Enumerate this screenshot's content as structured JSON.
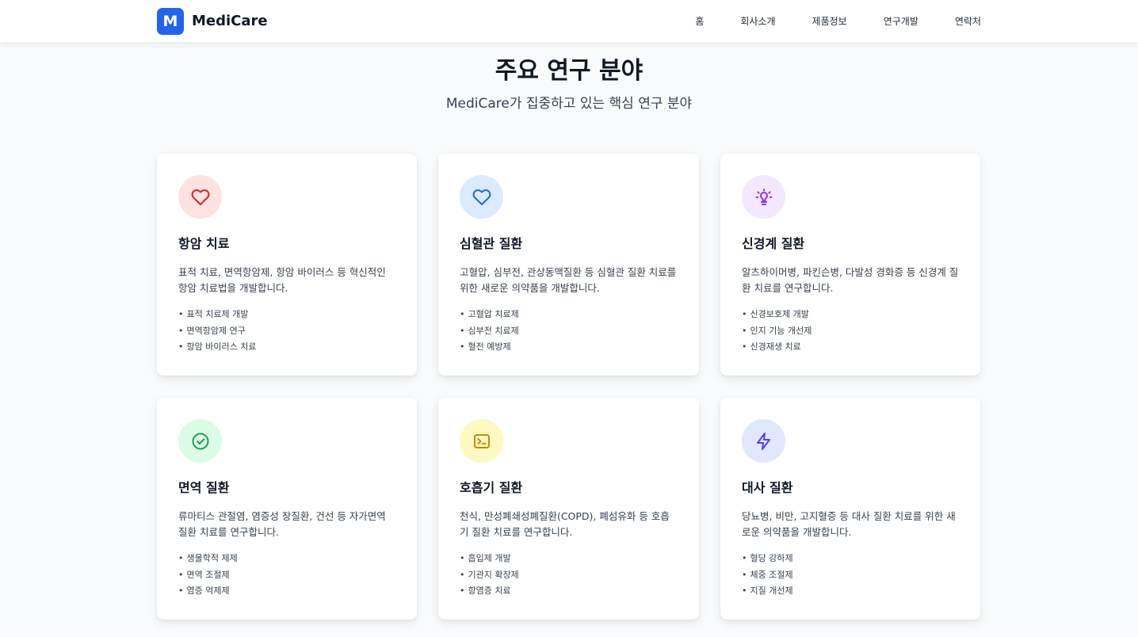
{
  "navbar": {
    "logo_letter": "M",
    "brand": "MediCare",
    "links": [
      "홈",
      "회사소개",
      "제품정보",
      "연구개발",
      "연락처"
    ]
  },
  "section": {
    "title": "주요 연구 분야",
    "subtitle": "MediCare가 집중하고 있는 핵심 연구 분야"
  },
  "colors": {
    "brand": "#2563eb"
  },
  "cards": [
    {
      "icon": "heart-icon",
      "icon_color": "#dc2626",
      "icon_bg": "#fee2e2",
      "title": "항암 치료",
      "desc": "표적 치료, 면역항암제, 항암 바이러스 등 혁신적인 항암 치료법을 개발합니다.",
      "items": [
        "표적 치료제 개발",
        "면역항암제 연구",
        "항암 바이러스 치료"
      ]
    },
    {
      "icon": "heart-icon",
      "icon_color": "#2563eb",
      "icon_bg": "#dbeafe",
      "title": "심혈관 질환",
      "desc": "고혈압, 심부전, 관상동맥질환 등 심혈관 질환 치료를 위한 새로운 의약품을 개발합니다.",
      "items": [
        "고혈압 치료제",
        "심부전 치료제",
        "혈전 예방제"
      ]
    },
    {
      "icon": "lightbulb-icon",
      "icon_color": "#9333ea",
      "icon_bg": "#f3e8ff",
      "title": "신경계 질환",
      "desc": "알츠하이머병, 파킨슨병, 다발성 경화증 등 신경계 질환 치료를 연구합니다.",
      "items": [
        "신경보호제 개발",
        "인지 기능 개선제",
        "신경재생 치료"
      ]
    },
    {
      "icon": "check-circle-icon",
      "icon_color": "#16a34a",
      "icon_bg": "#dcfce7",
      "title": "면역 질환",
      "desc": "류마티스 관절염, 염증성 장질환, 건선 등 자가면역 질환 치료를 연구합니다.",
      "items": [
        "생물학적 제제",
        "면역 조절제",
        "염증 억제제"
      ]
    },
    {
      "icon": "terminal-icon",
      "icon_color": "#ca8a04",
      "icon_bg": "#fef9c3",
      "title": "호흡기 질환",
      "desc": "천식, 만성폐쇄성폐질환(COPD), 폐섬유화 등 호흡기 질환 치료를 연구합니다.",
      "items": [
        "흡입제 개발",
        "기관지 확장제",
        "항염증 치료"
      ]
    },
    {
      "icon": "lightning-icon",
      "icon_color": "#4f46e5",
      "icon_bg": "#e0e7ff",
      "title": "대사 질환",
      "desc": "당뇨병, 비만, 고지혈증 등 대사 질환 치료를 위한 새로운 의약품을 개발합니다.",
      "items": [
        "혈당 강하제",
        "체중 조절제",
        "지질 개선제"
      ]
    }
  ]
}
